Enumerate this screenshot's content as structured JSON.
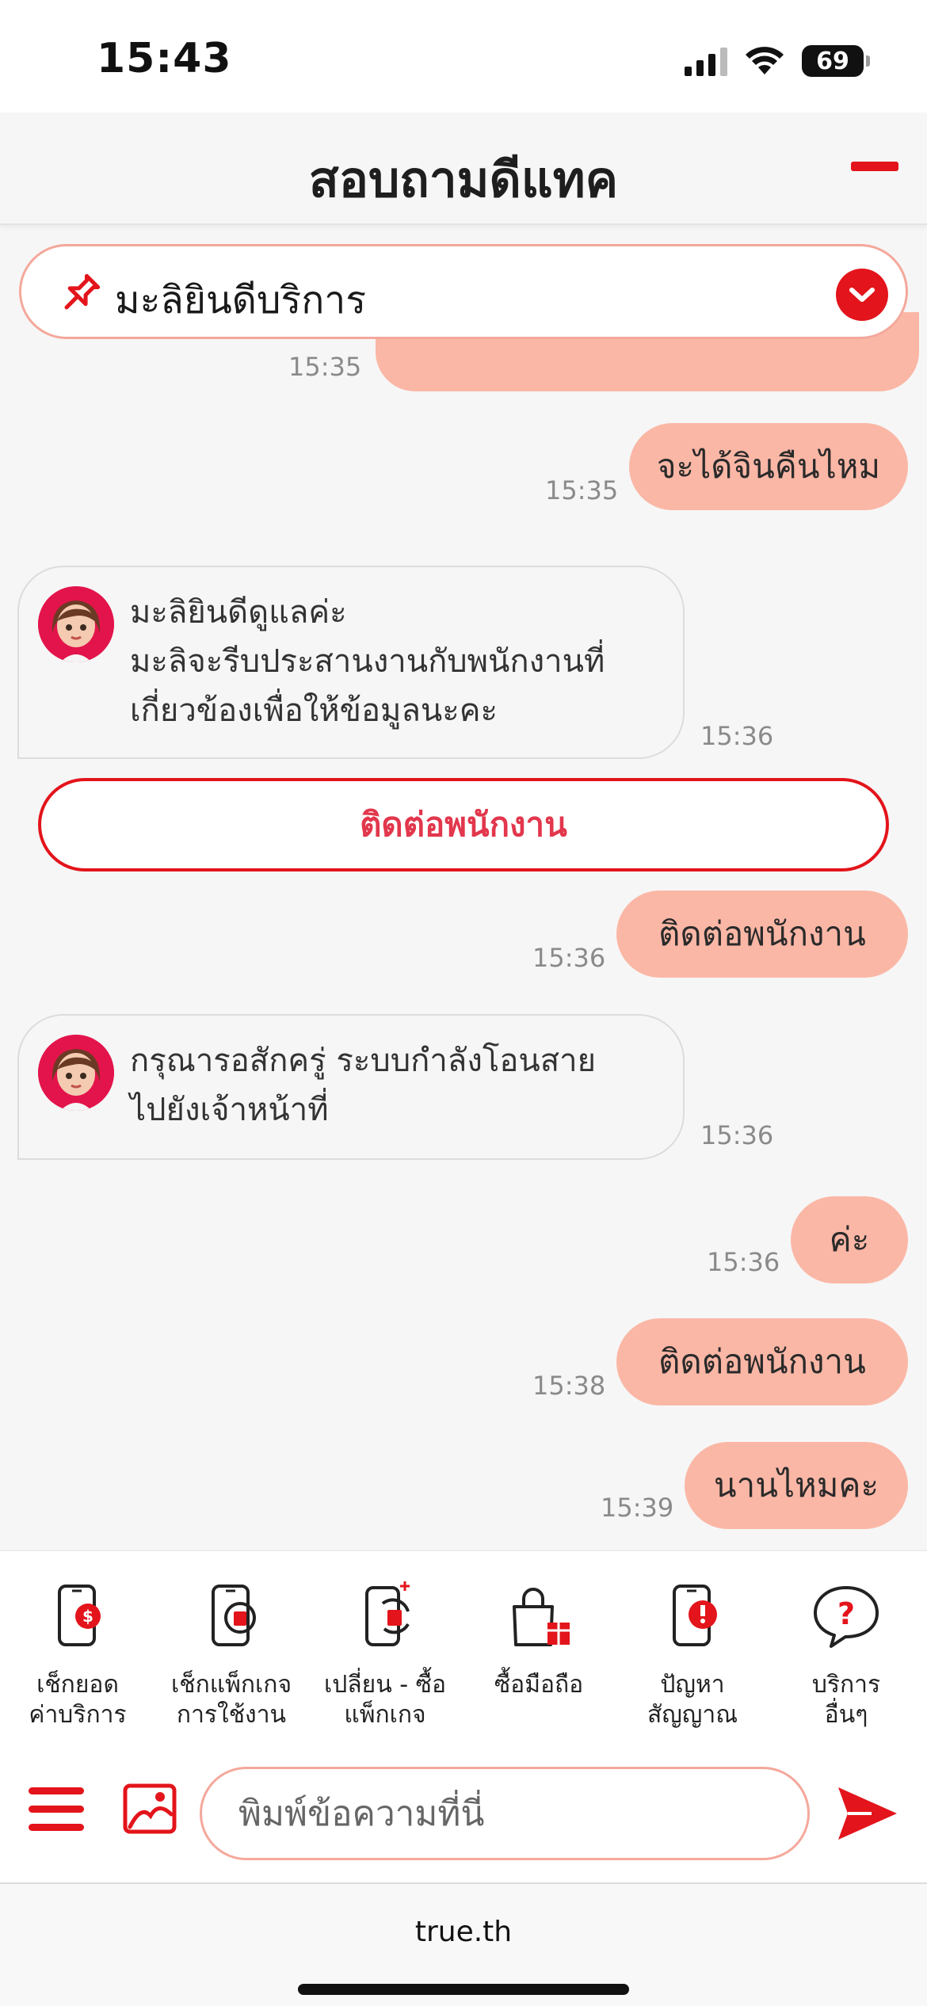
{
  "status_bar": {
    "time": "15:43",
    "battery": "69"
  },
  "header": {
    "title": "สอบถามดีแทค"
  },
  "pinned": {
    "title": "มะลิยินดีบริการ"
  },
  "messages": [
    {
      "time": "15:35"
    },
    {
      "text": "จะได้จินคืนไหม",
      "time": "15:35"
    },
    {
      "lines": [
        "มะลิยินดีดูแลค่ะ",
        "มะลิจะรีบประสานงานกับพนักงานที่",
        "เกี่ยวข้องเพื่อให้ข้อมูลนะคะ"
      ],
      "time": "15:36"
    },
    {
      "text": "ติดต่อพนักงาน",
      "time": "15:36"
    },
    {
      "lines": [
        "กรุณารอสักครู่ ระบบกำลังโอนสาย",
        "ไปยังเจ้าหน้าที่"
      ],
      "time": "15:36"
    },
    {
      "text": "ค่ะ",
      "time": "15:36"
    },
    {
      "text": "ติดต่อพนักงาน",
      "time": "15:38"
    },
    {
      "text": "นานไหมคะ",
      "time": "15:39"
    }
  ],
  "contact_button": {
    "label": "ติดต่อพนักงาน"
  },
  "quick_menu": [
    {
      "icon": "phone-bill-icon",
      "line1": "เช็กยอด",
      "line2": "ค่าบริการ"
    },
    {
      "icon": "phone-sim-icon",
      "line1": "เช็กแพ็กเกจ",
      "line2": "การใช้งาน"
    },
    {
      "icon": "phone-sim-swap-icon",
      "line1": "เปลี่ยน - ซื้อ",
      "line2": "แพ็กเกจ"
    },
    {
      "icon": "shopping-bag-icon",
      "line1": "ซื้อมือถือ",
      "line2": ""
    },
    {
      "icon": "phone-alert-icon",
      "line1": "ปัญหา",
      "line2": "สัญญาณ"
    },
    {
      "icon": "question-bubble-icon",
      "line1": "บริการ",
      "line2": "อื่นๆ"
    }
  ],
  "input": {
    "placeholder": "พิมพ์ข้อความที่นี่"
  },
  "browser": {
    "url": "true.th"
  },
  "colors": {
    "accent": "#e3141b",
    "user_bubble": "#fbb7a6",
    "outline": "#f4a89b"
  }
}
